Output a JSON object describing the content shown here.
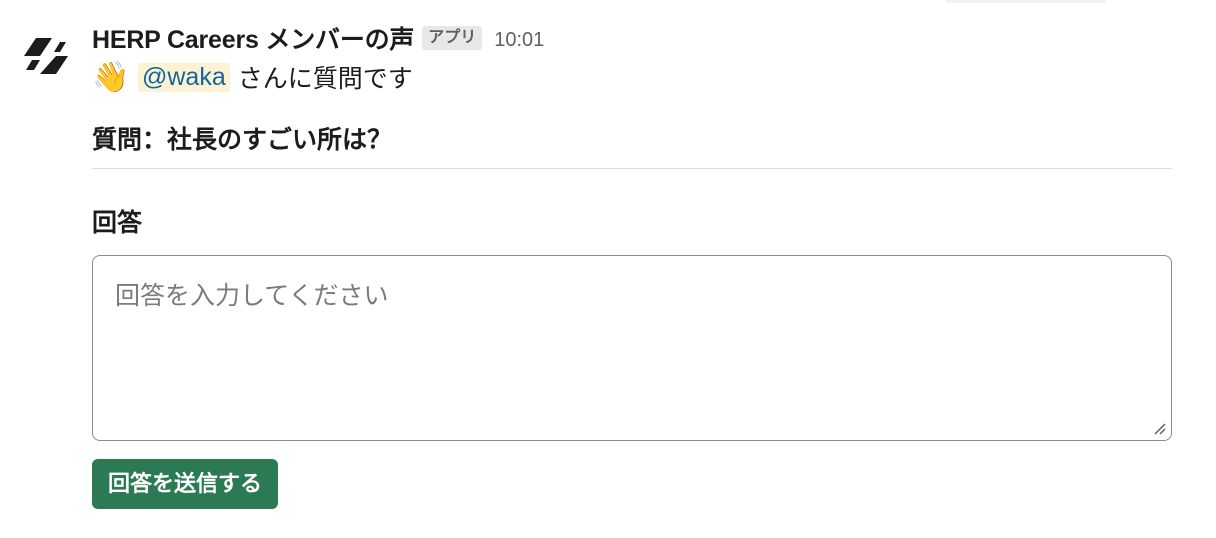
{
  "message": {
    "app_name": "HERP Careers メンバーの声",
    "app_badge": "アプリ",
    "timestamp": "10:01",
    "wave_icon": "👋",
    "mention": "@waka",
    "intro_text": "さんに質問です",
    "question": "質問：社長のすごい所は？"
  },
  "form": {
    "answer_label": "回答",
    "answer_value": "",
    "answer_placeholder": "回答を入力してください",
    "submit_label": "回答を送信する"
  },
  "colors": {
    "button_bg": "#2c7a54",
    "mention_bg": "#fdf3d2",
    "mention_text": "#1264a3"
  },
  "icons": {
    "avatar": "herp-logo-icon",
    "resize": "resize-handle-icon"
  }
}
